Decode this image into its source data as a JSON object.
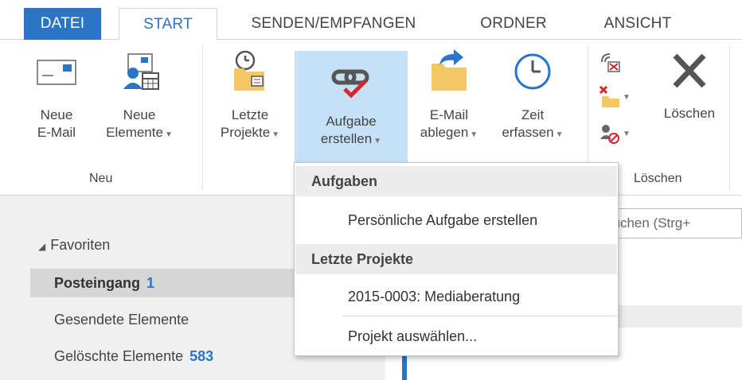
{
  "tabs": {
    "file": "DATEI",
    "start": "START",
    "send_receive": "SENDEN/EMPFANGEN",
    "folder": "ORDNER",
    "view": "ANSICHT"
  },
  "ribbon": {
    "new_email": [
      "Neue",
      "E-Mail"
    ],
    "new_items": [
      "Neue",
      "Elemente"
    ],
    "recent_projects": [
      "Letzte",
      "Projekte"
    ],
    "create_task": [
      "Aufgabe",
      "erstellen"
    ],
    "file_email": [
      "E-Mail",
      "ablegen"
    ],
    "log_time": [
      "Zeit",
      "erfassen"
    ],
    "delete": "Löschen",
    "group_new": "Neu",
    "group_delete": "Löschen"
  },
  "nav": {
    "favorites": "Favoriten",
    "inbox": "Posteingang",
    "inbox_count": "1",
    "sent": "Gesendete Elemente",
    "deleted": "Gelöschte Elemente",
    "deleted_count": "583"
  },
  "search": {
    "text": "suchen (Strg+"
  },
  "dropdown": {
    "header_tasks": "Aufgaben",
    "create_personal_task": "Persönliche Aufgabe erstellen",
    "header_recent": "Letzte Projekte",
    "recent_project": "2015-0003: Mediaberatung",
    "select_project": "Projekt auswählen..."
  },
  "colors": {
    "accent": "#2b74c6",
    "highlight": "#c5e0f7",
    "check_red": "#d9262c",
    "folder": "#f2c766"
  }
}
